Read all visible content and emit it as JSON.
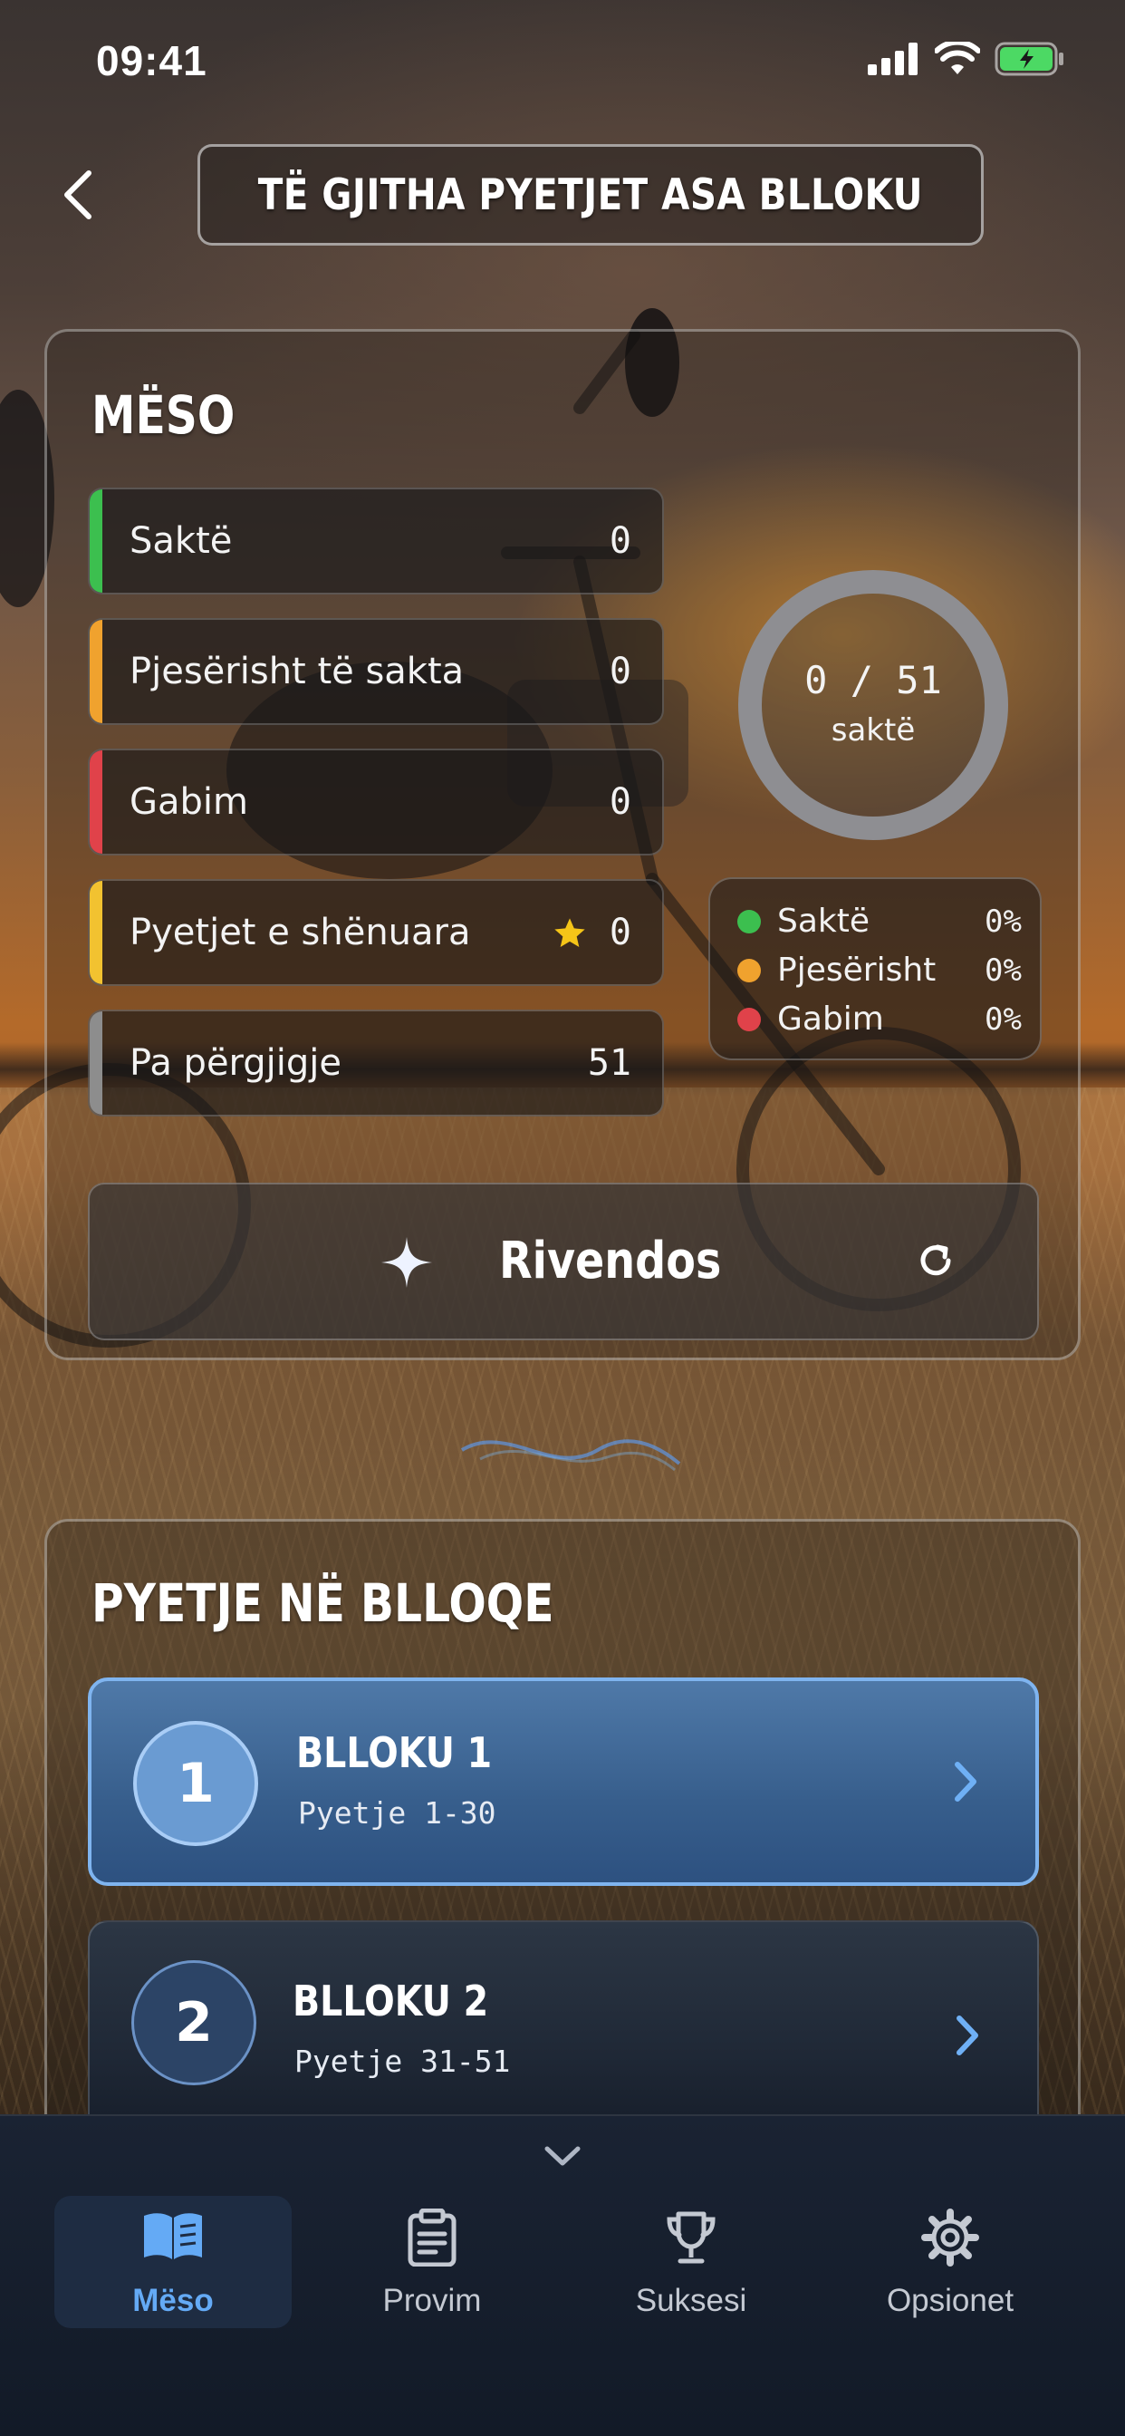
{
  "status_bar": {
    "time": "09:41"
  },
  "header": {
    "title": "TË GJITHA PYETJET ASA BLLOKU"
  },
  "learn": {
    "title": "MËSO",
    "stats": [
      {
        "label": "Saktë",
        "value": "0",
        "accent": "#3cbf4f"
      },
      {
        "label": "Pjesërisht të sakta",
        "value": "0",
        "accent": "#f0a22e"
      },
      {
        "label": "Gabim",
        "value": "0",
        "accent": "#e0424a"
      },
      {
        "label": "Pyetjet e shënuara",
        "value": "0",
        "accent": "#f2c230"
      },
      {
        "label": "Pa përgjigje",
        "value": "51",
        "accent": "#8d8d8d"
      }
    ],
    "donut": {
      "value": "0 / 51",
      "caption": "saktë",
      "correct": 0,
      "total": 51
    },
    "legend": [
      {
        "label": "Saktë",
        "pct": "0%",
        "color": "#3cbf4f"
      },
      {
        "label": "Pjesërisht",
        "pct": "0%",
        "color": "#f0a22e"
      },
      {
        "label": "Gabim",
        "pct": "0%",
        "color": "#e0424a"
      }
    ],
    "reset_label": "Rivendos"
  },
  "blocks": {
    "title": "PYETJE NË BLLOQE",
    "items": [
      {
        "number": "1",
        "title": "BLLOKU 1",
        "subtitle": "Pyetje 1-30"
      },
      {
        "number": "2",
        "title": "BLLOKU 2",
        "subtitle": "Pyetje 31-51"
      }
    ]
  },
  "tabs": [
    {
      "label": "Mëso",
      "icon": "book-icon",
      "selected": true
    },
    {
      "label": "Provim",
      "icon": "clipboard-icon",
      "selected": false
    },
    {
      "label": "Suksesi",
      "icon": "trophy-icon",
      "selected": false
    },
    {
      "label": "Opsionet",
      "icon": "gear-icon",
      "selected": false
    }
  ],
  "colors": {
    "accent": "#64aaf5",
    "active_block": "#375e8c"
  }
}
